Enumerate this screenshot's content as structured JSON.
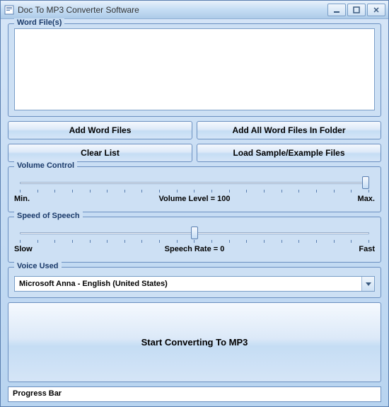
{
  "window": {
    "title": "Doc To MP3 Converter Software"
  },
  "file_section": {
    "legend": "Word File(s)"
  },
  "buttons": {
    "add_files": "Add Word Files",
    "add_folder": "Add All Word Files In Folder",
    "clear_list": "Clear List",
    "load_sample": "Load Sample/Example Files",
    "start": "Start Converting To MP3"
  },
  "volume": {
    "legend": "Volume Control",
    "min_label": "Min.",
    "max_label": "Max.",
    "level_label": "Volume Level = 100",
    "value": 100
  },
  "speed": {
    "legend": "Speed of Speech",
    "min_label": "Slow",
    "max_label": "Fast",
    "rate_label": "Speech Rate = 0",
    "value": 0
  },
  "voice": {
    "legend": "Voice Used",
    "selected": "Microsoft Anna - English (United States)"
  },
  "progress": {
    "label": "Progress Bar"
  }
}
